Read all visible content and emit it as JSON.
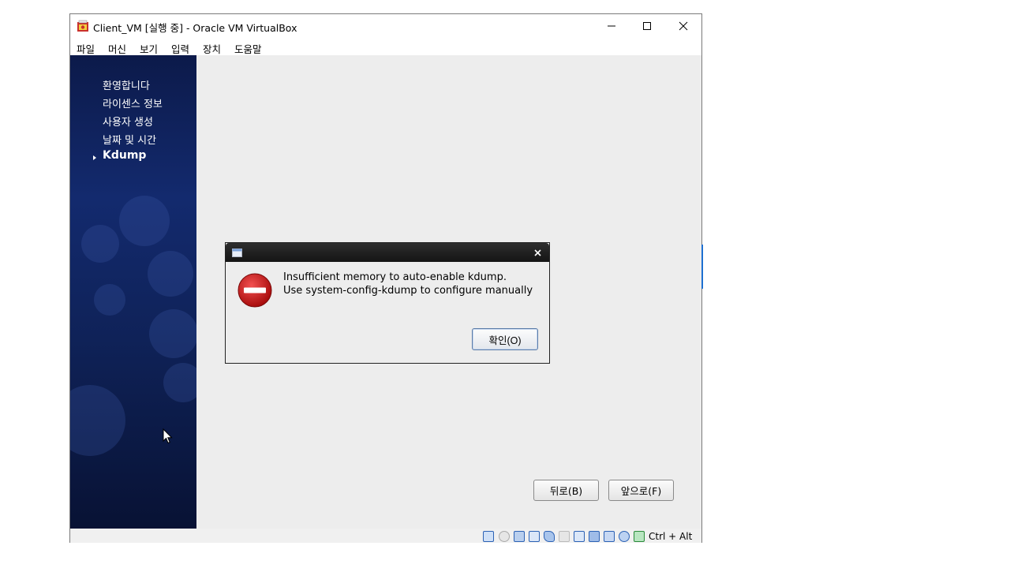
{
  "window": {
    "title": "Client_VM [실행 중] - Oracle VM VirtualBox",
    "controls": [
      "minimize",
      "maximize",
      "close"
    ]
  },
  "menu": {
    "items": [
      "파일",
      "머신",
      "보기",
      "입력",
      "장치",
      "도움말"
    ]
  },
  "installer": {
    "steps": [
      {
        "label": "환영합니다",
        "active": false
      },
      {
        "label": "라이센스 정보",
        "active": false
      },
      {
        "label": "사용자 생성",
        "active": false
      },
      {
        "label": "날짜 및 시간",
        "active": false
      },
      {
        "label": "Kdump",
        "active": true
      }
    ],
    "back_label": "뒤로(B)",
    "forward_label": "앞으로(F)"
  },
  "dialog": {
    "message_line1": "Insufficient memory to auto-enable kdump.",
    "message_line2": "Use system-config-kdump to configure manually",
    "ok_label": "확인(O)",
    "icon": "error-icon"
  },
  "statusbar": {
    "icons": [
      "hard-disk-icon",
      "optical-drive-icon",
      "audio-icon",
      "network-icon",
      "usb-icon",
      "shared-folder-icon",
      "display-icon",
      "recording-icon",
      "virtualization-icon",
      "mouse-integration-icon",
      "host-key-icon"
    ],
    "host_key": "Ctrl + Alt"
  },
  "colors": {
    "sidebar": "#132a6e",
    "error": "#cc1111",
    "ok_border": "#5c7ca8"
  }
}
